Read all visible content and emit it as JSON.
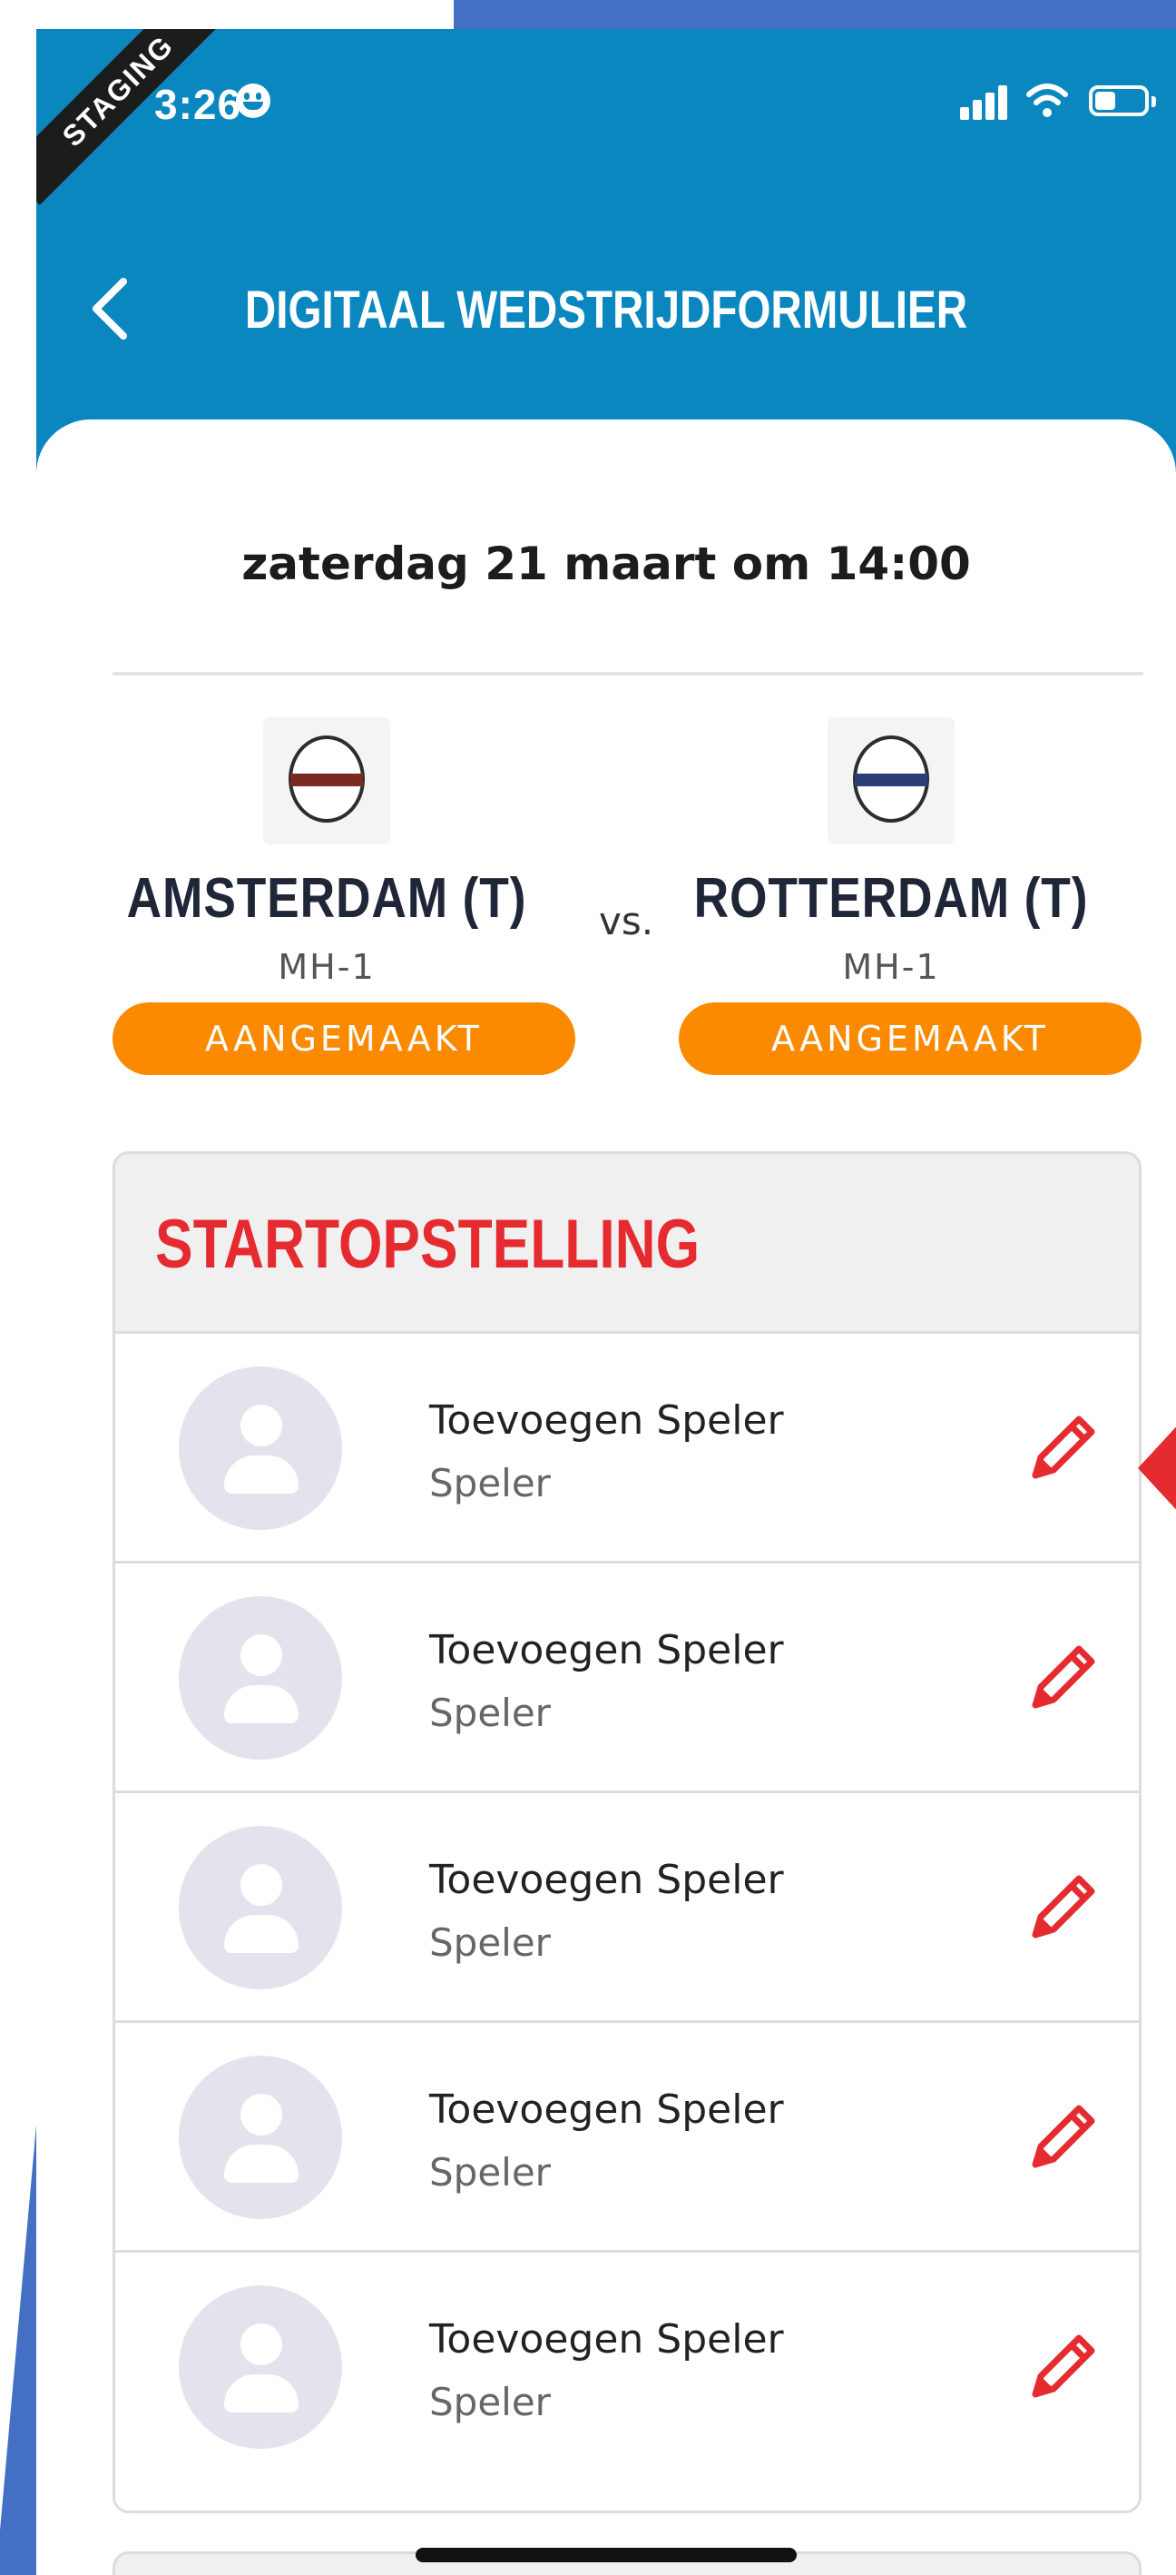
{
  "status_bar": {
    "time": "3:26",
    "staging_label": "STAGING"
  },
  "header": {
    "title": "DIGITAAL WEDSTRIJDFORMULIER",
    "back_icon": "chevron-left-icon"
  },
  "match": {
    "date": "zaterdag 21 maart om 14:00",
    "vs_label": "vs.",
    "home": {
      "name": "AMSTERDAM (T)",
      "level": "MH-1",
      "status": "AANGEMAAKT"
    },
    "away": {
      "name": "ROTTERDAM (T)",
      "level": "MH-1",
      "status": "AANGEMAAKT"
    }
  },
  "lineup": {
    "title": "STARTOPSTELLING",
    "rows": [
      {
        "name": "Toevoegen Speler",
        "role": "Speler"
      },
      {
        "name": "Toevoegen Speler",
        "role": "Speler"
      },
      {
        "name": "Toevoegen Speler",
        "role": "Speler"
      },
      {
        "name": "Toevoegen Speler",
        "role": "Speler"
      },
      {
        "name": "Toevoegen Speler",
        "role": "Speler"
      }
    ]
  },
  "colors": {
    "header_blue": "#0b87c0",
    "pill_orange": "#fb8a00",
    "accent_red": "#e52b30"
  }
}
